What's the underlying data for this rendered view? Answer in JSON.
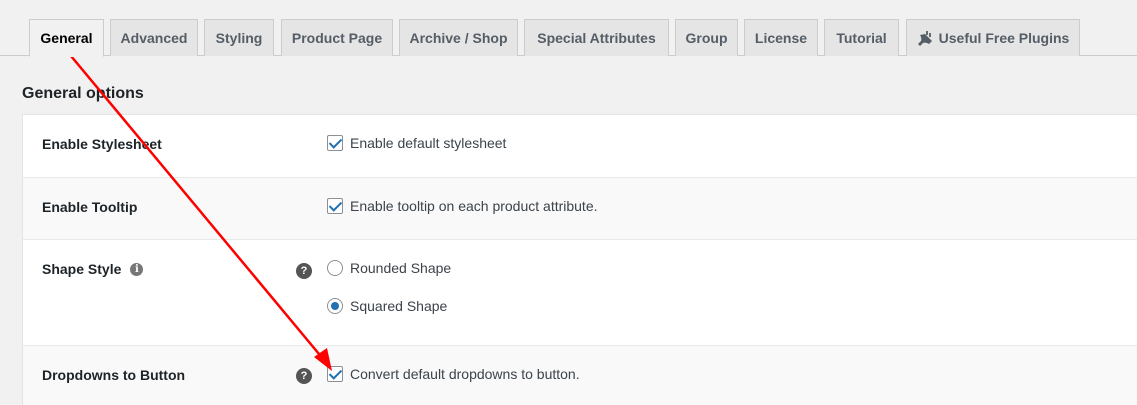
{
  "tabs": [
    {
      "label": "General",
      "active": true
    },
    {
      "label": "Advanced"
    },
    {
      "label": "Styling"
    },
    {
      "label": "Product Page"
    },
    {
      "label": "Archive / Shop"
    },
    {
      "label": "Special Attributes"
    },
    {
      "label": "Group"
    },
    {
      "label": "License"
    },
    {
      "label": "Tutorial"
    },
    {
      "label": "Useful Free Plugins",
      "icon": "plug-icon"
    }
  ],
  "section_title": "General options",
  "rows": {
    "stylesheet": {
      "label": "Enable Stylesheet",
      "option": "Enable default stylesheet",
      "checked": true
    },
    "tooltip": {
      "label": "Enable Tooltip",
      "option": "Enable tooltip on each product attribute.",
      "checked": true
    },
    "shape": {
      "label": "Shape Style",
      "info_icon": "i",
      "help_icon": "?",
      "options": [
        {
          "label": "Rounded Shape",
          "checked": false
        },
        {
          "label": "Squared Shape",
          "checked": true
        }
      ]
    },
    "dropdowns": {
      "label": "Dropdowns to Button",
      "help_icon": "?",
      "option": "Convert default dropdowns to button.",
      "checked": true
    }
  },
  "colors": {
    "accent": "#2271b1",
    "annotation_arrow": "#ff0000"
  }
}
